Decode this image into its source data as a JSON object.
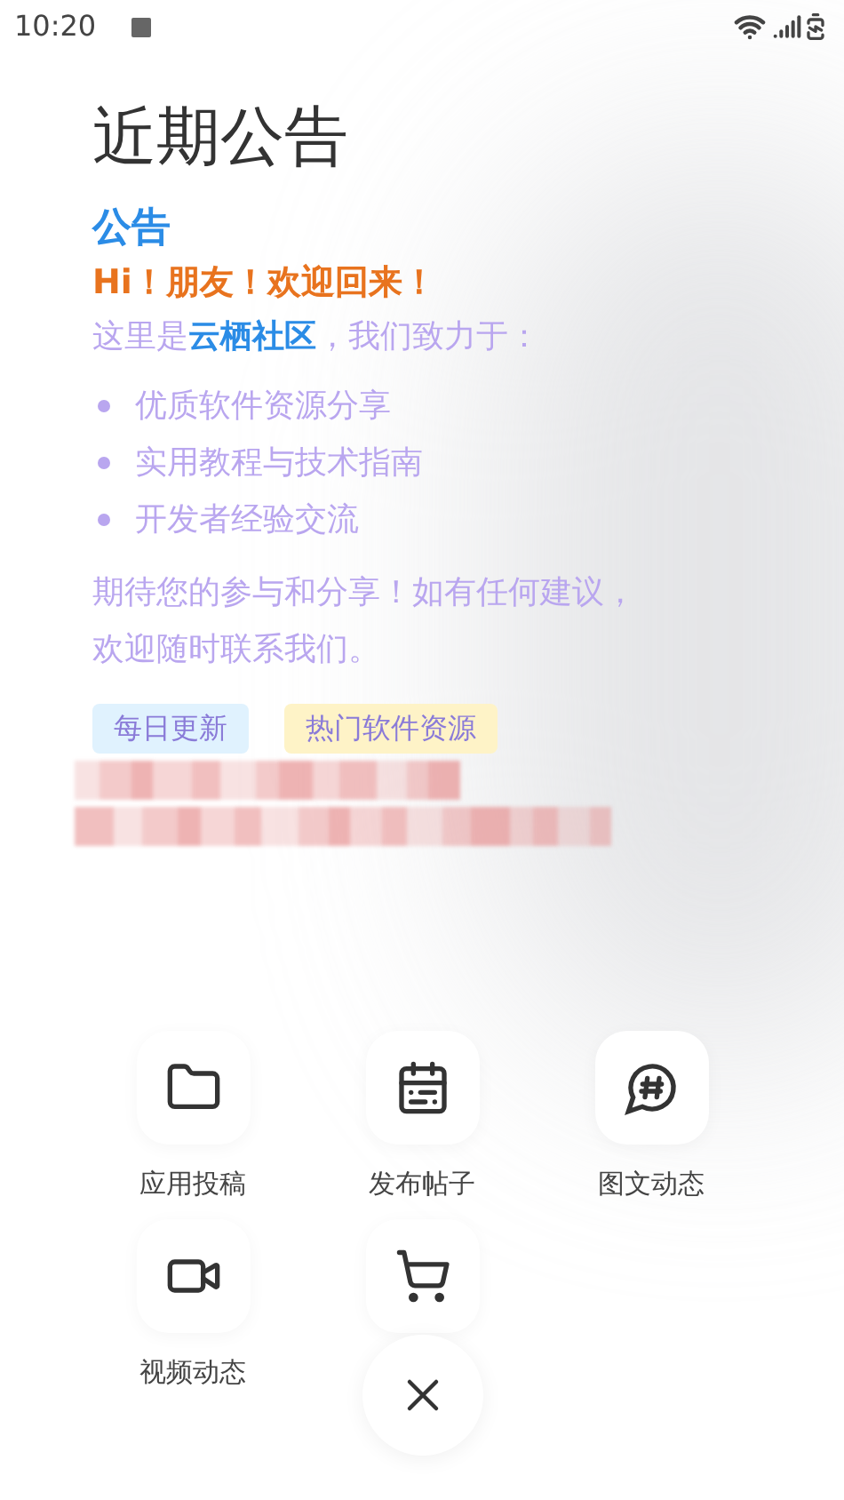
{
  "status_bar": {
    "time": "10:20"
  },
  "title": "近期公告",
  "notice": {
    "heading": "公告",
    "greeting": "Hi！朋友！欢迎回来！",
    "intro": "这里是**云栖社区**，我们致力于：",
    "bullets": [
      "优质软件资源分享",
      "实用教程与技术指南",
      "开发者经验交流"
    ],
    "closing": "期待您的参与和分享！如有任何建议，欢迎随时联系我们。",
    "tags": [
      {
        "label": "每日更新",
        "color": "#e0f2fe"
      },
      {
        "label": "热门软件资源",
        "color": "#fef3c7"
      }
    ]
  },
  "actions": [
    {
      "kind": "folder",
      "label": "应用投稿"
    },
    {
      "kind": "calendar",
      "label": "发布帖子"
    },
    {
      "kind": "hashtag",
      "label": "图文动态"
    },
    {
      "kind": "video",
      "label": "视频动态"
    },
    {
      "kind": "cart"
    }
  ]
}
